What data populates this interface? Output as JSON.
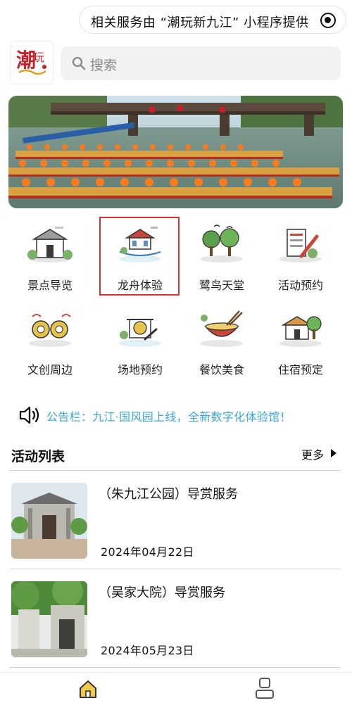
{
  "topbar": {
    "provider_text": "相关服务由 “潮玩新九江” 小程序提供",
    "icon": "target-icon"
  },
  "logo": {
    "icon": "chaowan-logo-icon"
  },
  "search": {
    "placeholder": "搜索",
    "icon": "search-icon"
  },
  "banner": {
    "icon": "dragon-boat-photo"
  },
  "grid": {
    "items": [
      {
        "label": "景点导览",
        "icon": "scenic-spot-icon"
      },
      {
        "label": "龙舟体验",
        "icon": "dragon-boat-icon",
        "selected": true
      },
      {
        "label": "鹭鸟天堂",
        "icon": "egret-paradise-icon"
      },
      {
        "label": "活动预约",
        "icon": "activity-booking-icon"
      },
      {
        "label": "文创周边",
        "icon": "cultural-product-icon"
      },
      {
        "label": "场地预约",
        "icon": "venue-booking-icon"
      },
      {
        "label": "餐饮美食",
        "icon": "food-bowl-icon"
      },
      {
        "label": "住宿预定",
        "icon": "lodging-icon"
      }
    ]
  },
  "notice": {
    "text": "公告栏：九江·国风园上线，全新数字化体验馆！",
    "icon": "speaker-icon"
  },
  "activities": {
    "title": "活动列表",
    "more_label": "更多",
    "items": [
      {
        "name": "（朱九江公园）导赏服务",
        "date": "2024年04月22日"
      },
      {
        "name": "（吴家大院）导赏服务",
        "date": "2024年05月23日"
      }
    ]
  },
  "tabbar": {
    "items": [
      {
        "icon": "home-icon",
        "active": true
      },
      {
        "icon": "user-icon",
        "active": false
      }
    ]
  },
  "colors": {
    "accent": "#3aa8d8",
    "selected_border": "#e03030",
    "home_icon": "#e8b41a"
  }
}
